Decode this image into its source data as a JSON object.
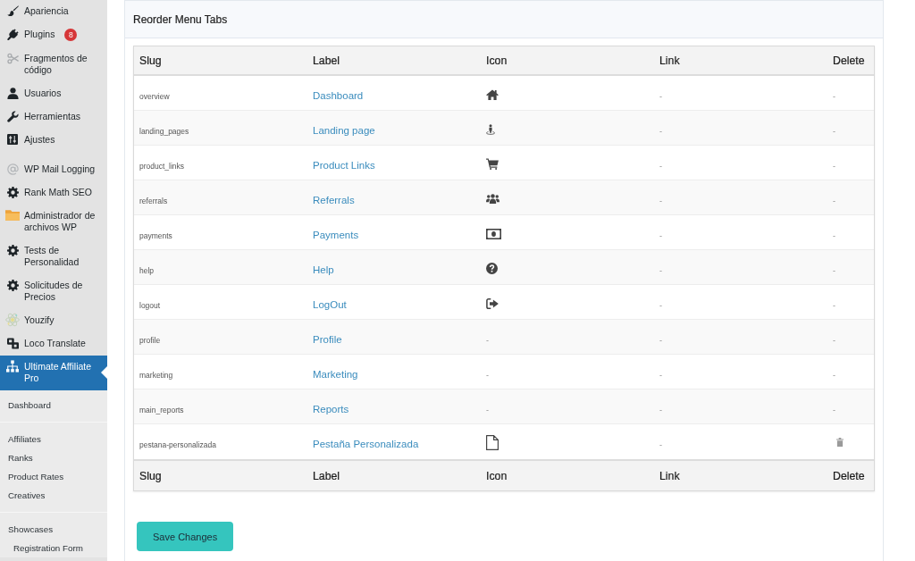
{
  "sidebar": {
    "menu_groups": [
      {
        "items": [
          {
            "label": "Apariencia",
            "selected": false
          },
          {
            "label": "Plugins",
            "badge": "8",
            "selected": false
          },
          {
            "label": "Fragmentos de código",
            "selected": false
          },
          {
            "label": "Usuarios",
            "selected": false
          },
          {
            "label": "Herramientas",
            "selected": false
          },
          {
            "label": "Ajustes",
            "selected": false
          }
        ]
      },
      {
        "items": [
          {
            "label": "WP Mail Logging",
            "selected": false
          },
          {
            "label": "Rank Math SEO",
            "selected": false
          },
          {
            "label": "Administrador de archivos WP",
            "selected": false
          },
          {
            "label": "Tests de Personalidad",
            "selected": false
          },
          {
            "label": "Solicitudes de Precios",
            "selected": false
          },
          {
            "label": "Youzify",
            "selected": false
          },
          {
            "label": "Loco Translate",
            "selected": false
          },
          {
            "label": "Ultimate Affiliate Pro",
            "selected": true,
            "submenu_groups": [
              {
                "items": [
                  {
                    "label": "Dashboard"
                  }
                ]
              },
              {
                "items": [
                  {
                    "label": "Affiliates"
                  },
                  {
                    "label": "Ranks"
                  },
                  {
                    "label": "Product Rates"
                  },
                  {
                    "label": "Creatives"
                  }
                ]
              },
              {
                "items": [
                  {
                    "label": "Showcases",
                    "children": [
                      {
                        "label": "Registration Form"
                      }
                    ]
                  }
                ]
              }
            ]
          }
        ]
      }
    ]
  },
  "panel": {
    "title": "Reorder Menu Tabs",
    "table": {
      "columns": [
        "Slug",
        "Label",
        "Icon",
        "Link",
        "Delete"
      ],
      "rows": [
        {
          "slug": "overview",
          "label": "Dashboard",
          "link": "-",
          "delete": "-"
        },
        {
          "slug": "landing_pages",
          "label": "Landing page",
          "link": "-",
          "delete": "-"
        },
        {
          "slug": "product_links",
          "label": "Product Links",
          "link": "-",
          "delete": "-"
        },
        {
          "slug": "referrals",
          "label": "Referrals",
          "link": "-",
          "delete": "-"
        },
        {
          "slug": "payments",
          "label": "Payments",
          "link": "-",
          "delete": "-"
        },
        {
          "slug": "help",
          "label": "Help",
          "link": "-",
          "delete": "-"
        },
        {
          "slug": "logout",
          "label": "LogOut",
          "link": "-",
          "delete": "-"
        },
        {
          "slug": "profile",
          "label": "Profile",
          "icon": "-",
          "link": "-",
          "delete": "-"
        },
        {
          "slug": "marketing",
          "label": "Marketing",
          "icon": "-",
          "link": "-",
          "delete": "-"
        },
        {
          "slug": "main_reports",
          "label": "Reports",
          "icon": "-",
          "link": "-",
          "delete": "-"
        },
        {
          "slug": "pestana-personalizada",
          "label": "Pestaña Personalizada",
          "link": "-"
        }
      ],
      "footer_columns": [
        "Slug",
        "Label",
        "Icon",
        "Link",
        "Delete"
      ]
    },
    "save_button": "Save Changes"
  }
}
